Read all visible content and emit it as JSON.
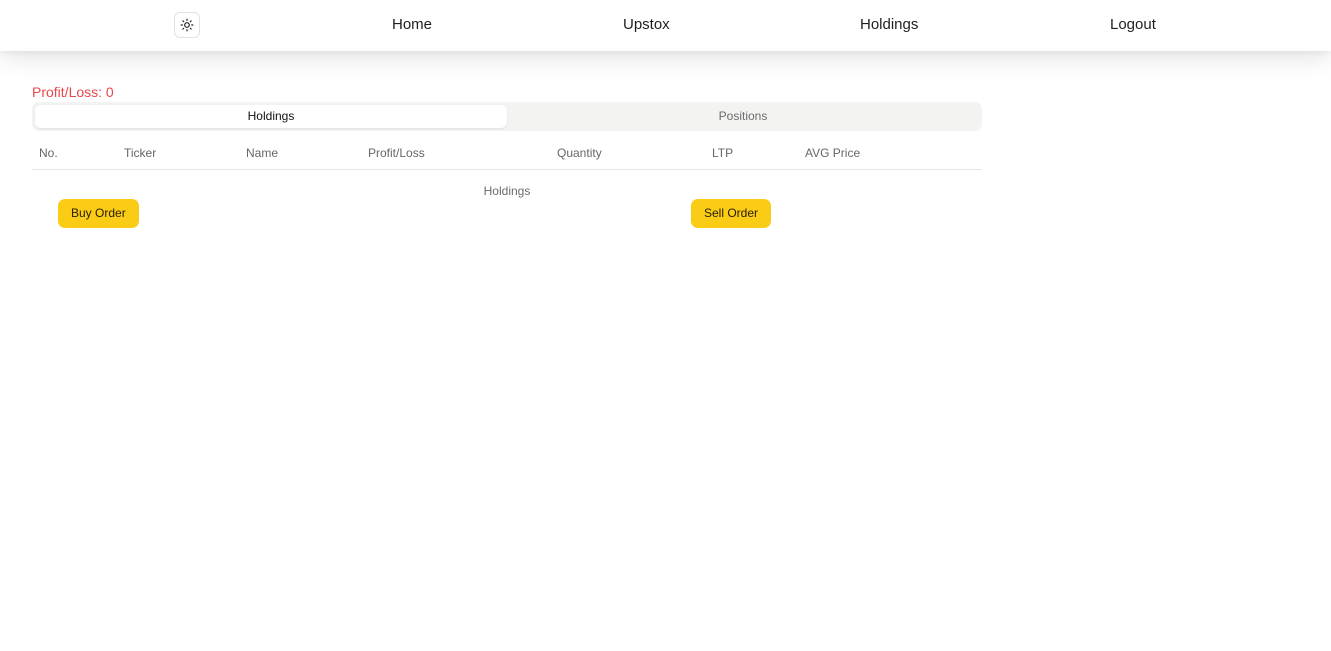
{
  "nav": {
    "theme_toggle_icon": "sun-icon",
    "links": [
      "Home",
      "Upstox",
      "Holdings",
      "Logout"
    ]
  },
  "summary": {
    "pnl_label": "Profit/Loss: 0",
    "pnl_color": "#e5484d"
  },
  "tabs": {
    "active": "Holdings",
    "inactive": "Positions"
  },
  "table": {
    "columns": [
      "No.",
      "Ticker",
      "Name",
      "Profit/Loss",
      "Quantity",
      "LTP",
      "AVG Price"
    ],
    "caption": "Holdings"
  },
  "actions": {
    "buy_label": "Buy Order",
    "sell_label": "Sell Order",
    "button_color": "#facc15"
  }
}
